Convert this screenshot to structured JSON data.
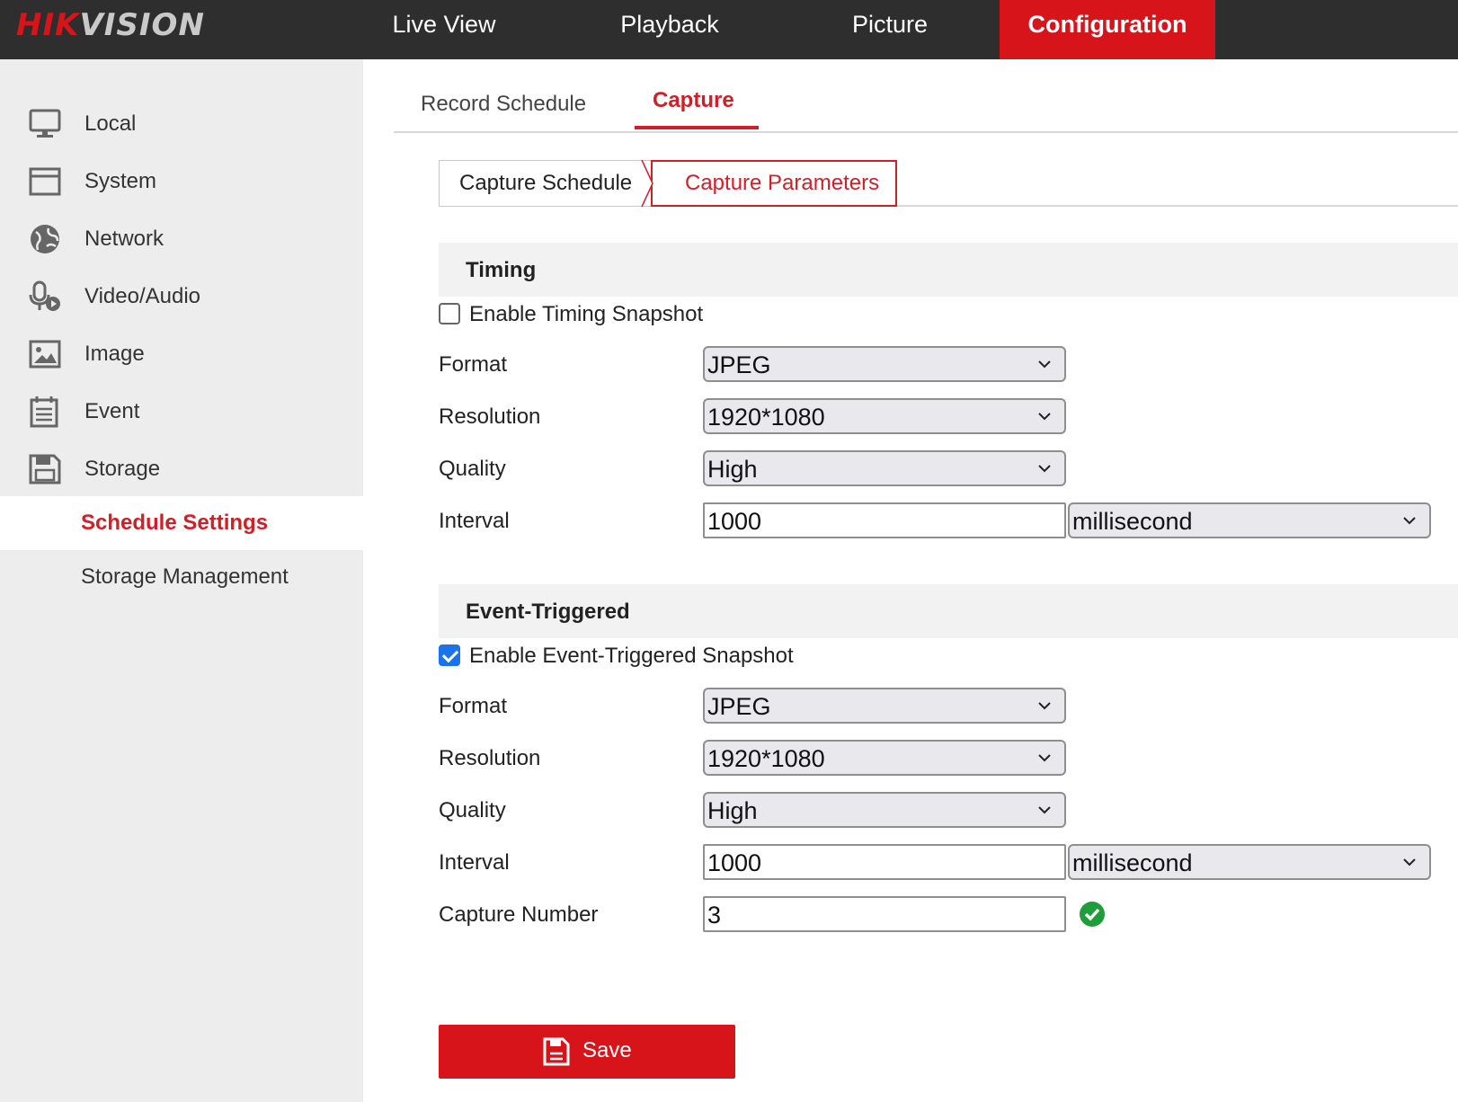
{
  "brand": {
    "logo_left": "HIK",
    "logo_right": "VISION",
    "accent": "#d7141a"
  },
  "topnav": {
    "items": [
      {
        "label": "Live View"
      },
      {
        "label": "Playback"
      },
      {
        "label": "Picture"
      },
      {
        "label": "Configuration",
        "active": true
      }
    ]
  },
  "sidebar": {
    "items": [
      {
        "label": "Local",
        "icon": "monitor-icon"
      },
      {
        "label": "System",
        "icon": "window-icon"
      },
      {
        "label": "Network",
        "icon": "globe-icon"
      },
      {
        "label": "Video/Audio",
        "icon": "microphone-icon"
      },
      {
        "label": "Image",
        "icon": "image-icon"
      },
      {
        "label": "Event",
        "icon": "calendar-icon"
      },
      {
        "label": "Storage",
        "icon": "floppy-disk-icon"
      }
    ],
    "subitems": [
      {
        "label": "Schedule Settings",
        "active": true
      },
      {
        "label": "Storage Management"
      }
    ]
  },
  "tabs": {
    "record_schedule": "Record Schedule",
    "capture": "Capture"
  },
  "subtabs": {
    "capture_schedule": "Capture Schedule",
    "capture_parameters": "Capture Parameters"
  },
  "timing": {
    "title": "Timing",
    "enable_label": "Enable Timing Snapshot",
    "enabled": false,
    "format_label": "Format",
    "format": "JPEG",
    "resolution_label": "Resolution",
    "resolution": "1920*1080",
    "quality_label": "Quality",
    "quality": "High",
    "interval_label": "Interval",
    "interval": "1000",
    "interval_unit": "millisecond"
  },
  "event": {
    "title": "Event-Triggered",
    "enable_label": "Enable Event-Triggered Snapshot",
    "enabled": true,
    "format_label": "Format",
    "format": "JPEG",
    "resolution_label": "Resolution",
    "resolution": "1920*1080",
    "quality_label": "Quality",
    "quality": "High",
    "interval_label": "Interval",
    "interval": "1000",
    "interval_unit": "millisecond",
    "capture_number_label": "Capture Number",
    "capture_number": "3"
  },
  "save_label": "Save"
}
